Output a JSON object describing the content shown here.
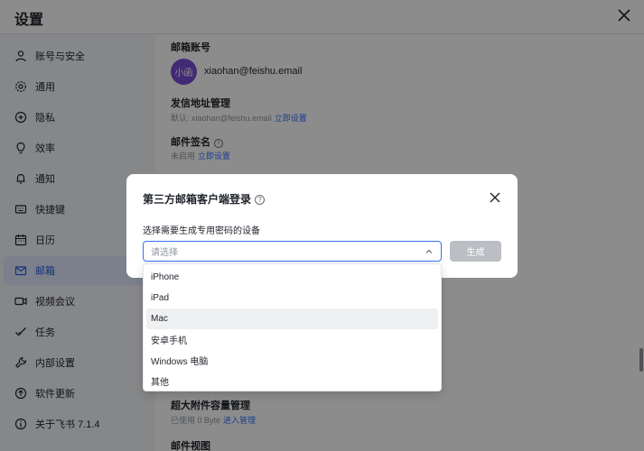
{
  "window": {
    "title": "设置"
  },
  "sidebar": {
    "items": [
      {
        "label": "账号与安全",
        "icon": "user-icon",
        "active": false
      },
      {
        "label": "通用",
        "icon": "gear-icon",
        "active": false
      },
      {
        "label": "隐私",
        "icon": "shield-icon",
        "active": false
      },
      {
        "label": "效率",
        "icon": "lightbulb-icon",
        "active": false
      },
      {
        "label": "通知",
        "icon": "bell-icon",
        "active": false
      },
      {
        "label": "快捷键",
        "icon": "keyboard-icon",
        "active": false
      },
      {
        "label": "日历",
        "icon": "calendar-icon",
        "active": false
      },
      {
        "label": "邮箱",
        "icon": "mail-icon",
        "active": true
      },
      {
        "label": "视频会议",
        "icon": "video-icon",
        "active": false
      },
      {
        "label": "任务",
        "icon": "check-icon",
        "active": false
      },
      {
        "label": "内部设置",
        "icon": "wrench-icon",
        "active": false
      },
      {
        "label": "软件更新",
        "icon": "update-icon",
        "active": false
      },
      {
        "label": "关于飞书 7.1.4",
        "icon": "info-icon",
        "active": false
      }
    ]
  },
  "content": {
    "account_title": "邮箱账号",
    "avatar_text": "小函",
    "email": "xiaohan@feishu.email",
    "sender_title": "发信地址管理",
    "sender_default": "默认: xiaohan@feishu.email",
    "sender_link": "立即设置",
    "signature_title": "邮件签名",
    "signature_status": "未启用",
    "signature_link": "立即设置",
    "attachment_title": "超大附件容量管理",
    "attachment_used": "已使用 0 Byte",
    "attachment_link": "进入管理",
    "view_title": "邮件视图"
  },
  "modal": {
    "title": "第三方邮箱客户端登录",
    "label": "选择需要生成专用密码的设备",
    "select_placeholder": "请选择",
    "generate_button": "生成",
    "options": [
      "iPhone",
      "iPad",
      "Mac",
      "安卓手机",
      "Windows 电脑",
      "其他"
    ],
    "hovered_option": "Mac"
  },
  "colors": {
    "accent": "#3370ff",
    "active_bg": "#e1eaff",
    "avatar_bg": "#7b4ed4",
    "disabled_btn": "#bbbfc4"
  }
}
